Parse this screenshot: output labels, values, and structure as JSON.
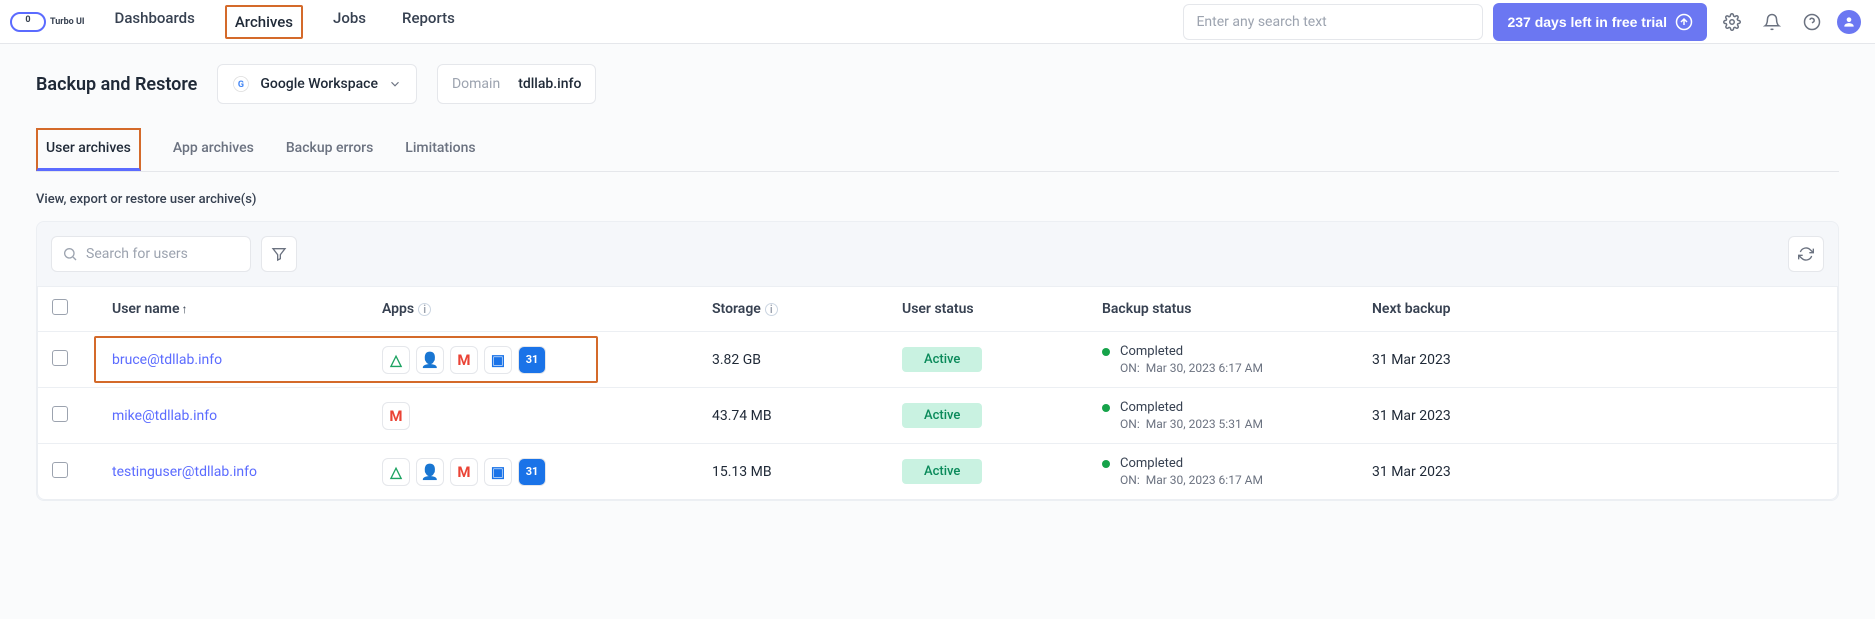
{
  "header": {
    "brand_text": "Turbo UI",
    "nav": {
      "dashboards": "Dashboards",
      "archives": "Archives",
      "jobs": "Jobs",
      "reports": "Reports"
    },
    "search_placeholder": "Enter any search text",
    "trial_label": "237 days left in free trial"
  },
  "page": {
    "title": "Backup and Restore",
    "workspace_selector": "Google Workspace",
    "domain_label": "Domain",
    "domain_value": "tdllab.info"
  },
  "tabs": {
    "user_archives": "User archives",
    "app_archives": "App archives",
    "backup_errors": "Backup errors",
    "limitations": "Limitations"
  },
  "subtitle": "View, export or restore user archive(s)",
  "user_search_placeholder": "Search for users",
  "table": {
    "headers": {
      "username": "User name",
      "apps": "Apps",
      "storage": "Storage",
      "user_status": "User status",
      "backup_status": "Backup status",
      "next_backup": "Next backup"
    },
    "on_label": "ON:",
    "rows": [
      {
        "username": "bruce@tdllab.info",
        "apps": [
          "drive",
          "contacts",
          "gmail",
          "chat",
          "calendar"
        ],
        "storage": "3.82 GB",
        "user_status": "Active",
        "backup_status": "Completed",
        "backup_on": "Mar 30, 2023 6:17 AM",
        "next_backup": "31 Mar 2023",
        "highlight": true
      },
      {
        "username": "mike@tdllab.info",
        "apps": [
          "gmail"
        ],
        "storage": "43.74 MB",
        "user_status": "Active",
        "backup_status": "Completed",
        "backup_on": "Mar 30, 2023 5:31 AM",
        "next_backup": "31 Mar 2023",
        "highlight": false
      },
      {
        "username": "testinguser@tdllab.info",
        "apps": [
          "drive",
          "contacts",
          "gmail",
          "chat",
          "calendar"
        ],
        "storage": "15.13 MB",
        "user_status": "Active",
        "backup_status": "Completed",
        "backup_on": "Mar 30, 2023 6:17 AM",
        "next_backup": "31 Mar 2023",
        "highlight": false
      }
    ]
  },
  "app_icons": {
    "drive": "△",
    "contacts": "👤",
    "gmail": "M",
    "chat": "▣",
    "calendar": "31"
  },
  "app_colors": {
    "drive": "#1ea362",
    "contacts": "#1a73e8",
    "gmail": "#ea4335",
    "chat": "#1a73e8",
    "calendar": "#1a73e8"
  }
}
